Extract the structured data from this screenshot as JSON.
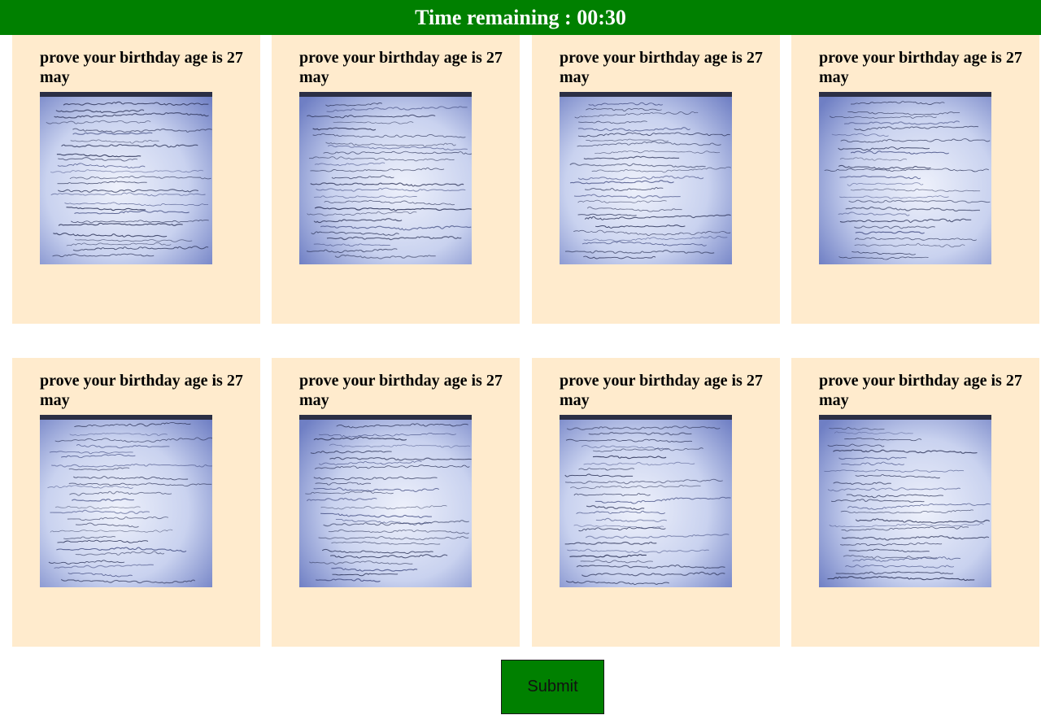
{
  "header": {
    "label": "Time remaining",
    "separator": " : ",
    "time": "00:30",
    "color": "#008000"
  },
  "cards": [
    {
      "title": "prove your birthday age is 27 may",
      "image_icon": "handwritten-page-image"
    },
    {
      "title": "prove your birthday age is 27 may",
      "image_icon": "handwritten-page-image"
    },
    {
      "title": "prove your birthday age is 27 may",
      "image_icon": "handwritten-page-image"
    },
    {
      "title": "prove your birthday age is 27 may",
      "image_icon": "handwritten-page-image"
    },
    {
      "title": "prove your birthday age is 27 may",
      "image_icon": "handwritten-page-image"
    },
    {
      "title": "prove your birthday age is 27 may",
      "image_icon": "handwritten-page-image"
    },
    {
      "title": "prove your birthday age is 27 may",
      "image_icon": "handwritten-page-image"
    },
    {
      "title": "prove your birthday age is 27 may",
      "image_icon": "handwritten-page-image"
    }
  ],
  "card_color": "#ffebcd",
  "submit": {
    "label": "Submit",
    "color": "#008000"
  }
}
